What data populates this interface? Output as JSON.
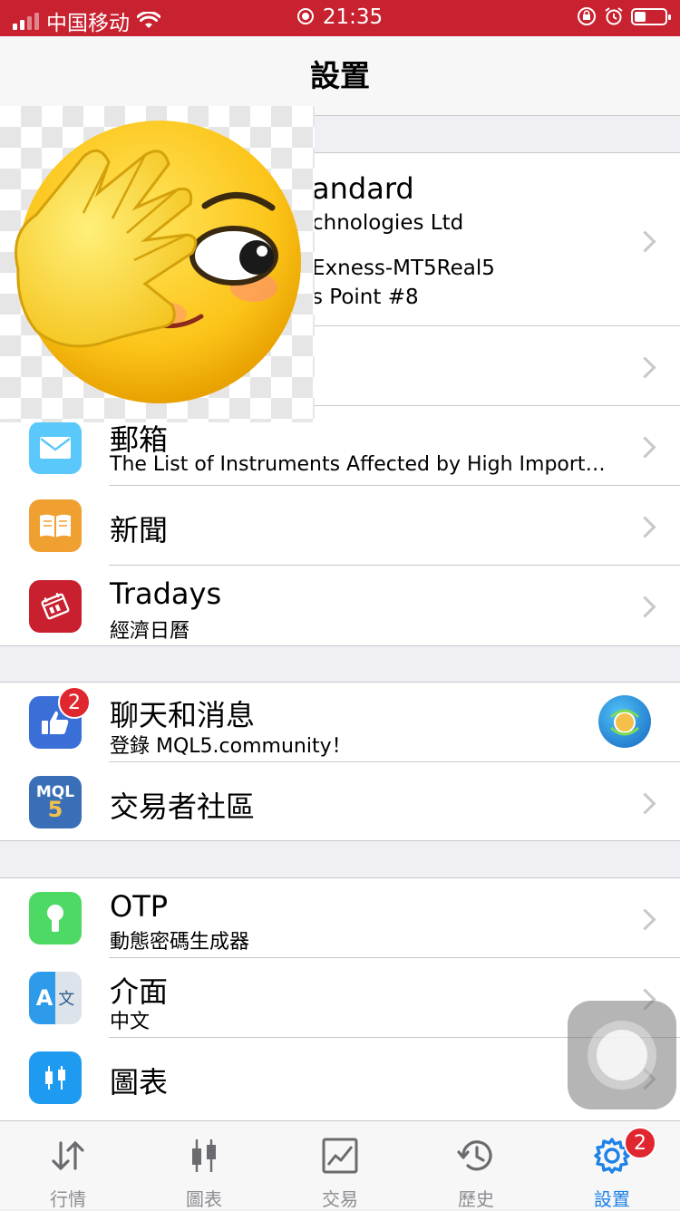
{
  "status_bar": {
    "carrier": "中国移动",
    "time": "21:35"
  },
  "nav": {
    "title": "設置"
  },
  "account": {
    "line1": "andard",
    "line2": "chnologies Ltd",
    "line3": "Exness-MT5Real5",
    "line4": "s Point #8"
  },
  "mail": {
    "title": "郵箱",
    "subtitle": "The List of Instruments Affected by High Import…"
  },
  "news": {
    "title": "新聞"
  },
  "tradays": {
    "title": "Tradays",
    "subtitle": "經濟日曆"
  },
  "chat": {
    "title": "聊天和消息",
    "subtitle": "登錄 MQL5.community！",
    "badge": "2"
  },
  "community": {
    "title": "交易者社區",
    "icon_text": "MQL",
    "icon_digit": "5"
  },
  "otp": {
    "title": "OTP",
    "subtitle": "動態密碼生成器"
  },
  "interface": {
    "title": "介面",
    "subtitle": "中文",
    "icon_a": "A",
    "icon_b": "文"
  },
  "charts": {
    "title": "圖表"
  },
  "tabs": [
    {
      "label": "行情",
      "icon": "quotes-arrows-icon"
    },
    {
      "label": "圖表",
      "icon": "candlestick-icon"
    },
    {
      "label": "交易",
      "icon": "trade-chart-icon"
    },
    {
      "label": "歷史",
      "icon": "history-clock-icon"
    },
    {
      "label": "設置",
      "icon": "gear-icon",
      "badge": "2",
      "active": true
    }
  ],
  "colors": {
    "status_bar": "#c8212f",
    "accent": "#1e82e6",
    "badge": "#e0262f"
  }
}
